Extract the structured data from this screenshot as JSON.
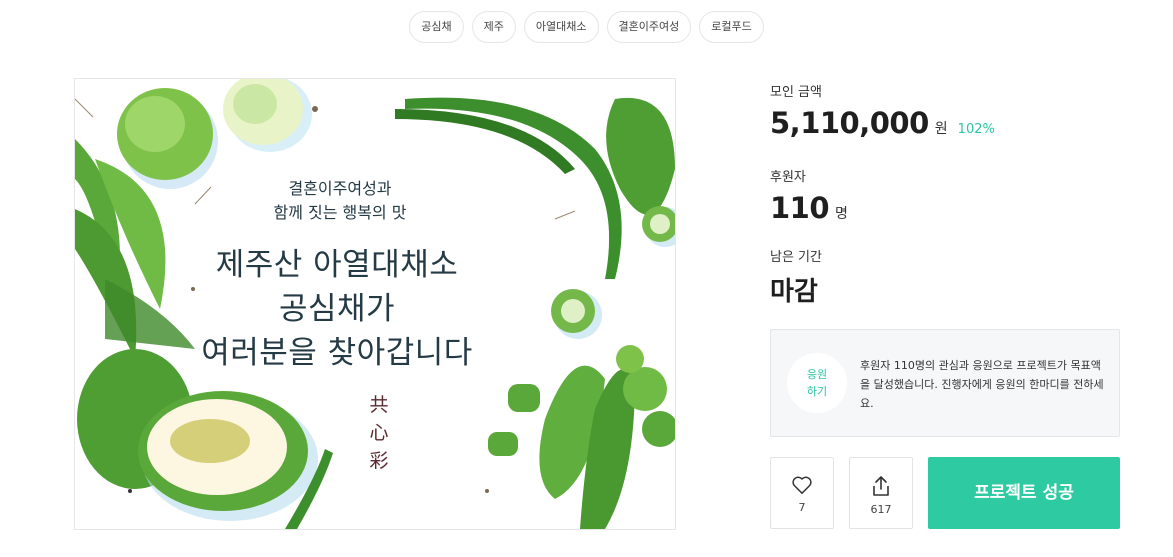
{
  "tags": [
    "공심채",
    "제주",
    "아열대채소",
    "결혼이주여성",
    "로컬푸드"
  ],
  "visual": {
    "sub_line1": "결혼이주여성과",
    "sub_line2": "함께 짓는 행복의 맛",
    "title_line1": "제주산 아열대채소",
    "title_line2": "공심채가",
    "title_line3": "여러분을 찾아갑니다",
    "brand_chars": [
      "共",
      "心",
      "彩"
    ]
  },
  "funding": {
    "amount_label": "모인 금액",
    "amount": "5,110,000",
    "amount_unit": "원",
    "percent": "102%",
    "backers_label": "후원자",
    "backers": "110",
    "backers_unit": "명",
    "remaining_label": "남은 기간",
    "remaining": "마감"
  },
  "cheer": {
    "button_line1": "응원",
    "button_line2": "하기",
    "message": "후원자 110명의 관심과 응원으로 프로젝트가 목표액을 달성했습니다. 진행자에게 응원의 한마디를 전하세요."
  },
  "actions": {
    "like_count": "7",
    "share_count": "617",
    "success_label": "프로젝트 성공"
  },
  "colors": {
    "accent": "#2ecaa1",
    "text_dark": "#1f1f1f",
    "headline": "#243a45"
  },
  "icons": [
    "heart-icon",
    "share-icon"
  ]
}
